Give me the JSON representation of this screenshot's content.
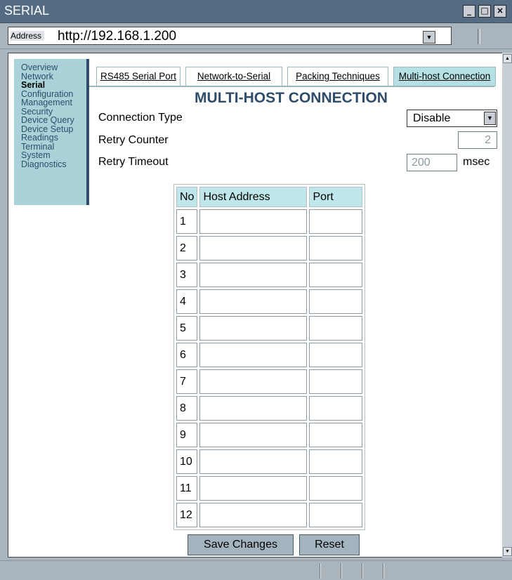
{
  "window": {
    "title": "SERIAL",
    "controls": [
      "minimize-icon",
      "maximize-icon",
      "close-icon"
    ]
  },
  "address": {
    "label": "Address",
    "url": "http://192.168.1.200"
  },
  "sidebar": {
    "items": [
      {
        "label": "Overview",
        "active": false
      },
      {
        "label": "Network",
        "active": false
      },
      {
        "label": "Serial",
        "active": true
      },
      {
        "label": "Configuration",
        "active": false
      },
      {
        "label": "Management",
        "active": false
      },
      {
        "label": "Security",
        "active": false
      },
      {
        "label": "Device Query",
        "active": false
      },
      {
        "label": "Device Setup",
        "active": false
      },
      {
        "label": "Readings",
        "active": false
      },
      {
        "label": "Terminal",
        "active": false
      },
      {
        "label": "System",
        "active": false
      },
      {
        "label": "Diagnostics",
        "active": false
      }
    ]
  },
  "tabs": [
    {
      "label": "RS485 Serial Port",
      "active": false
    },
    {
      "label": "Network-to-Serial",
      "active": false
    },
    {
      "label": "Packing Techniques",
      "active": false
    },
    {
      "label": "Multi-host Connection",
      "active": true
    }
  ],
  "page": {
    "heading": "MULTI-HOST CONNECTION",
    "connection_type": {
      "label": "Connection Type",
      "value": "Disable"
    },
    "retry_counter": {
      "label": "Retry Counter",
      "value": "2"
    },
    "retry_timeout": {
      "label": "Retry Timeout",
      "value": "200",
      "unit": "msec"
    }
  },
  "table": {
    "headers": [
      "No",
      "Host Address",
      "Port"
    ],
    "rows": [
      {
        "no": "1",
        "host": "",
        "port": ""
      },
      {
        "no": "2",
        "host": "",
        "port": ""
      },
      {
        "no": "3",
        "host": "",
        "port": ""
      },
      {
        "no": "4",
        "host": "",
        "port": ""
      },
      {
        "no": "5",
        "host": "",
        "port": ""
      },
      {
        "no": "6",
        "host": "",
        "port": ""
      },
      {
        "no": "7",
        "host": "",
        "port": ""
      },
      {
        "no": "8",
        "host": "",
        "port": ""
      },
      {
        "no": "9",
        "host": "",
        "port": ""
      },
      {
        "no": "10",
        "host": "",
        "port": ""
      },
      {
        "no": "11",
        "host": "",
        "port": ""
      },
      {
        "no": "12",
        "host": "",
        "port": ""
      }
    ]
  },
  "buttons": {
    "save": "Save Changes",
    "reset": "Reset"
  },
  "colors": {
    "titlebar": "#536c84",
    "sidebar_bg": "#a9d3d9",
    "accent": "#2f4d6a",
    "tab_active": "#b5e0e4",
    "table_header": "#bfe6ea",
    "button": "#a4b4bf"
  }
}
